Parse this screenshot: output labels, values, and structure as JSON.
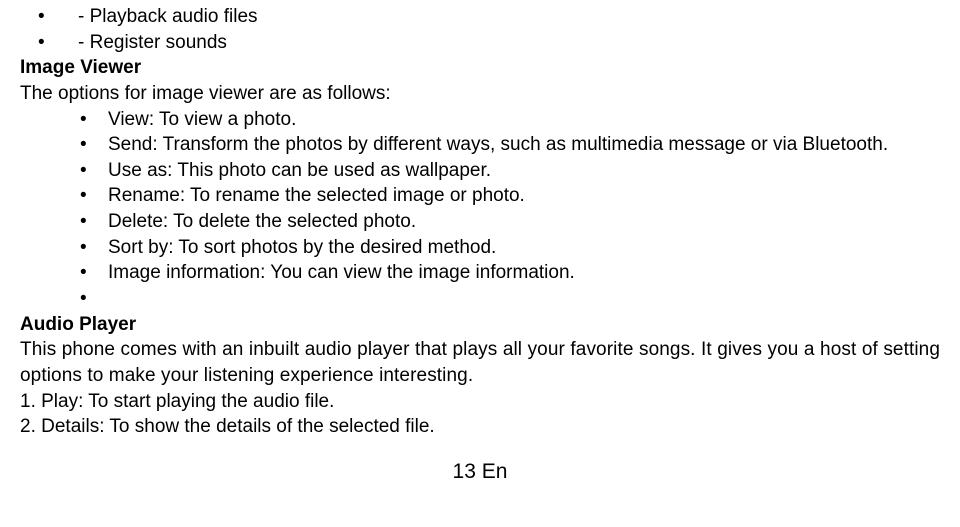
{
  "top_bullets": [
    "- Playback audio files",
    "- Register sounds"
  ],
  "section1": {
    "heading": "Image Viewer",
    "intro": "The options for image viewer are as follows:",
    "options": [
      "View: To view a photo.",
      "Send: Transform the photos by different ways, such as multimedia message or via Bluetooth.",
      "Use as: This photo can be used as wallpaper.",
      "Rename: To rename the selected image or photo.",
      "Delete: To delete the selected photo.",
      "Sort by: To sort photos by the desired method.",
      "Image information: You can view the image information."
    ]
  },
  "section2": {
    "heading": "Audio Player",
    "para": "This phone comes with an inbuilt audio player that plays all your favorite songs. It gives you a host of setting options to make your listening experience interesting.",
    "numbered": [
      "1. Play: To start playing the audio file.",
      "2. Details: To show the details of the selected file."
    ]
  },
  "pagenum": "13 En"
}
